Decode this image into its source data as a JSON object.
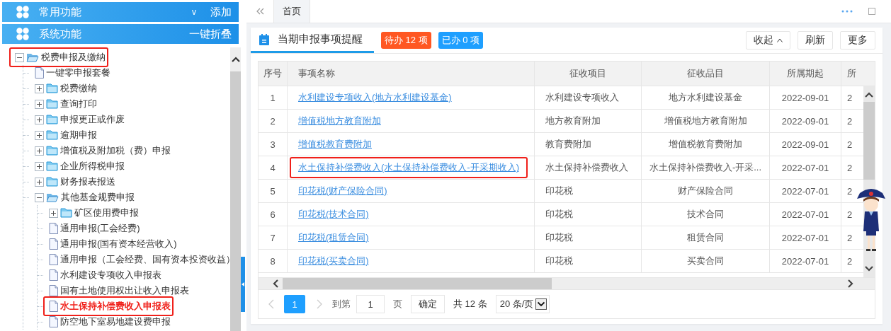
{
  "sidebar": {
    "sections": [
      {
        "title": "常用功能",
        "toggle": "v",
        "action": "添加"
      },
      {
        "title": "系统功能",
        "action": "一键折叠"
      }
    ],
    "tree": [
      {
        "label": "税费申报及缴纳",
        "kind": "folder",
        "expanded": true,
        "highlighted": true,
        "selected": false,
        "children": [
          {
            "label": "一键零申报套餐",
            "kind": "file",
            "highlighted": false,
            "selected": false
          },
          {
            "label": "税费缴纳",
            "kind": "folder",
            "expanded": false,
            "highlighted": false,
            "selected": false
          },
          {
            "label": "查询打印",
            "kind": "folder",
            "expanded": false,
            "highlighted": false,
            "selected": false
          },
          {
            "label": "申报更正或作废",
            "kind": "folder",
            "expanded": false,
            "highlighted": false,
            "selected": false
          },
          {
            "label": "逾期申报",
            "kind": "folder",
            "expanded": false,
            "highlighted": false,
            "selected": false
          },
          {
            "label": "增值税及附加税（费）申报",
            "kind": "folder",
            "expanded": false,
            "highlighted": false,
            "selected": false
          },
          {
            "label": "企业所得税申报",
            "kind": "folder",
            "expanded": false,
            "highlighted": false,
            "selected": false
          },
          {
            "label": "财务报表报送",
            "kind": "folder",
            "expanded": false,
            "highlighted": false,
            "selected": false
          },
          {
            "label": "其他基金规费申报",
            "kind": "folder",
            "expanded": true,
            "highlighted": false,
            "selected": false,
            "children": [
              {
                "label": "矿区使用费申报",
                "kind": "folder",
                "expanded": false,
                "highlighted": false,
                "selected": false
              },
              {
                "label": "通用申报(工会经费)",
                "kind": "file",
                "highlighted": false,
                "selected": false
              },
              {
                "label": "通用申报(国有资本经营收入)",
                "kind": "file",
                "highlighted": false,
                "selected": false
              },
              {
                "label": "通用申报（工会经费、国有资本投资收益）",
                "kind": "file",
                "highlighted": false,
                "selected": false
              },
              {
                "label": "水利建设专项收入申报表",
                "kind": "file",
                "highlighted": false,
                "selected": false
              },
              {
                "label": "国有土地使用权出让收入申报表",
                "kind": "file",
                "highlighted": false,
                "selected": false
              },
              {
                "label": "水土保持补偿费收入申报表",
                "kind": "file",
                "highlighted": true,
                "selected": true
              },
              {
                "label": "防空地下室易地建设费申报",
                "kind": "file",
                "highlighted": false,
                "selected": false
              }
            ]
          }
        ]
      }
    ]
  },
  "tabs": [
    {
      "label": "首页",
      "selected": true
    }
  ],
  "card": {
    "title": "当期申报事项提醒",
    "badges": [
      {
        "label": "待办 12 项",
        "color": "#ff5722"
      },
      {
        "label": "已办 0 项",
        "color": "#1e9fff"
      }
    ],
    "buttons": [
      {
        "label": "收起",
        "kind": "collapse"
      },
      {
        "label": "刷新",
        "kind": "plain"
      },
      {
        "label": "更多",
        "kind": "plain"
      }
    ]
  },
  "table": {
    "columns": [
      "序号",
      "事项名称",
      "征收项目",
      "征收品目",
      "所属期起",
      "所"
    ],
    "rows": [
      {
        "no": "1",
        "name": "水利建设专项收入(地方水利建设基金)",
        "item": "水利建设专项收入",
        "category": "地方水利建设基金",
        "start": "2022-09-01",
        "column_6": "2",
        "highlighted": false
      },
      {
        "no": "2",
        "name": "增值税地方教育附加",
        "item": "地方教育附加",
        "category": "增值税地方教育附加",
        "start": "2022-09-01",
        "column_6": "2",
        "highlighted": false
      },
      {
        "no": "3",
        "name": "增值税教育费附加",
        "item": "教育费附加",
        "category": "增值税教育费附加",
        "start": "2022-09-01",
        "column_6": "2",
        "highlighted": false
      },
      {
        "no": "4",
        "name": "水土保持补偿费收入(水土保持补偿费收入-开采期收入)",
        "item": "水土保持补偿费收入",
        "category": "水土保持补偿费收入-开采...",
        "start": "2022-07-01",
        "column_6": "2",
        "highlighted": true
      },
      {
        "no": "5",
        "name": "印花税(财产保险合同)",
        "item": "印花税",
        "category": "财产保险合同",
        "start": "2022-07-01",
        "column_6": "2",
        "highlighted": false
      },
      {
        "no": "6",
        "name": "印花税(技术合同)",
        "item": "印花税",
        "category": "技术合同",
        "start": "2022-07-01",
        "column_6": "2",
        "highlighted": false
      },
      {
        "no": "7",
        "name": "印花税(租赁合同)",
        "item": "印花税",
        "category": "租赁合同",
        "start": "2022-07-01",
        "column_6": "2",
        "highlighted": false
      },
      {
        "no": "8",
        "name": "印花税(买卖合同)",
        "item": "印花税",
        "category": "买卖合同",
        "start": "2022-07-01",
        "column_6": "2",
        "highlighted": false
      }
    ]
  },
  "pagination": {
    "pages": [
      {
        "label": "1",
        "selected": true
      }
    ],
    "goto_label": "到第",
    "goto_value": "1",
    "page_unit": "页",
    "confirm": "确定",
    "total": "共 12 条",
    "page_size": "20 条/页"
  }
}
